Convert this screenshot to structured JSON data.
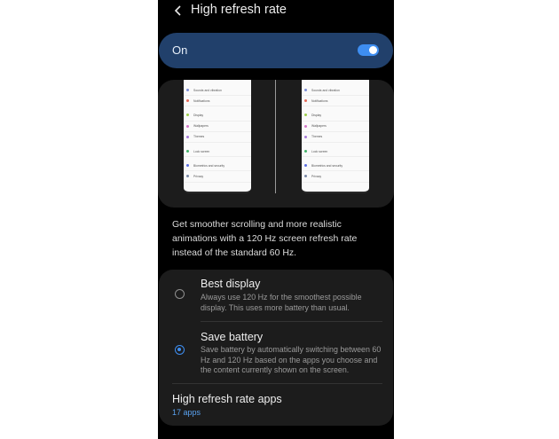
{
  "header": {
    "title": "High refresh rate",
    "back_icon": "chevron-left-icon"
  },
  "master_switch": {
    "label": "On",
    "state": true,
    "accent_color": "#3e8ef1",
    "background": "#21406b"
  },
  "preview": {
    "left_items": [
      {
        "label": "Sounds and vibration",
        "color": "#7e8fd6"
      },
      {
        "label": "Notifications",
        "color": "#e56b5b"
      },
      {
        "label": "Display",
        "color": "#9ccd4c",
        "gap": true
      },
      {
        "label": "Wallpapers",
        "color": "#d276c8"
      },
      {
        "label": "Themes",
        "color": "#a67ad8"
      },
      {
        "label": "Lock screen",
        "color": "#45b36b",
        "gap": true
      },
      {
        "label": "Biometrics and security",
        "color": "#5b6ee0",
        "gap": true
      },
      {
        "label": "Privacy",
        "color": "#7a88a6"
      }
    ],
    "right_items": [
      {
        "label": "Sounds and vibration",
        "color": "#7e8fd6"
      },
      {
        "label": "Notifications",
        "color": "#e56b5b"
      },
      {
        "label": "Display",
        "color": "#9ccd4c",
        "gap": true
      },
      {
        "label": "Wallpapers",
        "color": "#d276c8"
      },
      {
        "label": "Themes",
        "color": "#a67ad8"
      },
      {
        "label": "Lock screen",
        "color": "#45b36b",
        "gap": true
      },
      {
        "label": "Biometrics and security",
        "color": "#5b6ee0",
        "gap": true
      },
      {
        "label": "Privacy",
        "color": "#7a88a6"
      }
    ]
  },
  "description": "Get smoother scrolling and more realistic animations with a 120 Hz screen refresh rate instead of the standard 60 Hz.",
  "options": [
    {
      "title": "Best display",
      "desc": "Always use 120 Hz for the smoothest possible display. This uses more battery than usual.",
      "selected": false
    },
    {
      "title": "Save battery",
      "desc": "Save battery by automatically switching between 60 Hz and 120 Hz based on the apps you choose and the content currently shown on the screen.",
      "selected": true
    }
  ],
  "apps": {
    "title": "High refresh rate apps",
    "count": "17 apps"
  }
}
